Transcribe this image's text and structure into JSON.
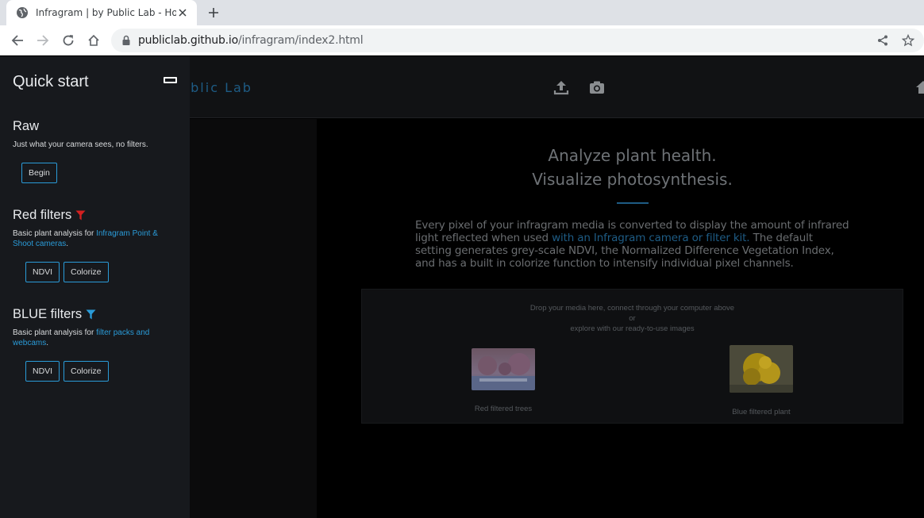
{
  "browser": {
    "tab_title": "Infragram | by Public Lab - Home",
    "url_host": "publiclab.github.io",
    "url_path": "/infragram/index2.html"
  },
  "header": {
    "brand": "ublic Lab",
    "icons": [
      "upload-icon",
      "camera-icon",
      "home-icon"
    ]
  },
  "hero": {
    "line1": "Analyze plant health.",
    "line2": "Visualize photosynthesis."
  },
  "description": {
    "part1": "Every pixel of your infragram media is converted to display the amount of infrared light reflected when used ",
    "link": "with an Infragram camera or filter kit.",
    "part2": " The default setting generates grey-scale NDVI, the Normalized Difference Vegetation Index, and has a built in colorize function to intensify individual pixel channels."
  },
  "dropzone": {
    "line1": "Drop your media here, connect through your computer above",
    "line2": "or",
    "line3": "explore with our ready-to-use images",
    "samples": [
      {
        "label": "Red filtered trees"
      },
      {
        "label": "Blue filtered plant"
      }
    ]
  },
  "sidebar": {
    "title": "Quick start",
    "raw": {
      "title": "Raw",
      "text": "Just what your camera sees, no filters.",
      "button": "Begin"
    },
    "red": {
      "title": "Red filters",
      "text_prefix": "Basic plant analysis for ",
      "link": "Infragram Point & Shoot cameras",
      "text_suffix": ".",
      "buttons": [
        "NDVI",
        "Colorize"
      ],
      "icon_color": "#d32020"
    },
    "blue": {
      "title": "BLUE filters",
      "text_prefix": "Basic plant analysis for ",
      "link": "filter packs and webcams",
      "text_suffix": ".",
      "buttons": [
        "NDVI",
        "Colorize"
      ],
      "icon_color": "#2a9bd8"
    }
  },
  "colors": {
    "accent": "#2a9bd8",
    "brand_dim": "#1e5c85"
  }
}
